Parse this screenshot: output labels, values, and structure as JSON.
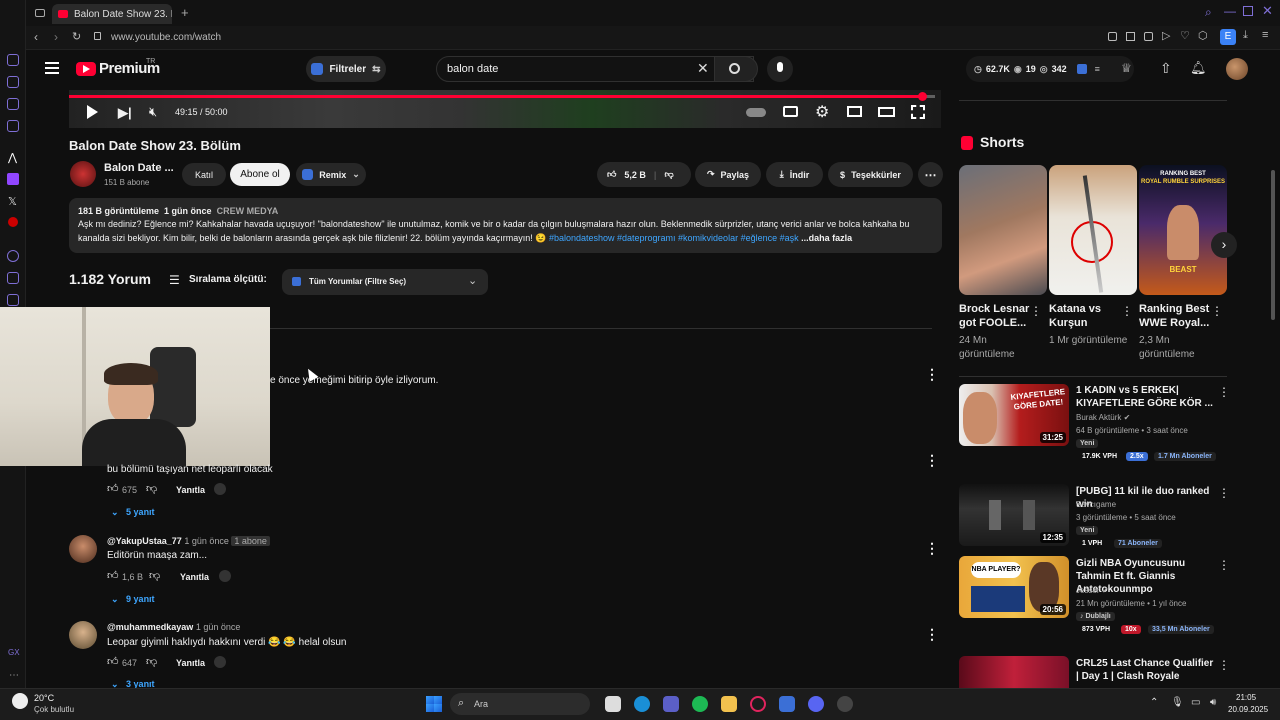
{
  "browser": {
    "tab_title": "Balon Date Show 23. Bölüm",
    "url": "www.youtube.com/watch"
  },
  "masthead": {
    "logo": "Premium",
    "logo_sup": "TR",
    "filter_label": "Filtreler",
    "search_value": "balon date",
    "stats": {
      "views": "62.7K",
      "watching": "19",
      "other": "342"
    },
    "colors": {
      "brand": "#ff0033",
      "accent": "#3ea6ff"
    }
  },
  "player": {
    "time": "49:15 / 50:00",
    "progress": 0.985
  },
  "video": {
    "title": "Balon Date Show 23. Bölüm",
    "channel": "Balon Date ...",
    "subscribers": "151 B abone",
    "join_label": "Katıl",
    "subscribe_label": "Abone ol",
    "remix_label": "Remix",
    "likes": "5,2 B",
    "share_label": "Paylaş",
    "download_label": "İndir",
    "thanks_label": "Teşekkürler"
  },
  "description": {
    "views": "181 B görüntüleme",
    "age": "1 gün önce",
    "channel_tag": "CREW MEDYA",
    "text_line1": "Aşk mı dediniz? Eğlence mi? Kahkahalar havada uçuşuyor! \"balondateshow\" ile unutulmaz, komik ve bir o kadar da çılgın buluşmalara hazır olun. Beklenmedik sürprizler, utanç verici anlar ve bolca kahkaha bu",
    "text_line2": "kanalda sizi bekliyor. Kim bilir, belki de balonların arasında gerçek aşk bile filizlenir! 22. bölüm yayında kaçırmayın! 😉",
    "hashtags": "#balondateshow #dateprogramı #komikvideolar #eğlence #aşk",
    "more": "...daha fazla"
  },
  "comments_header": {
    "count": "1.182 Yorum",
    "sort_label": "Sıralama ölçütü:",
    "filter_value": "Tüm Yorumlar (Filtre Seç)"
  },
  "comments": [
    {
      "text": "e önce yemeğimi bitirip öyle izliyorum."
    },
    {
      "text": "bu bölümü taşıyan net leoparlı olacak",
      "likes": "675",
      "reply": "Yanıtla",
      "replies": "5 yanıt"
    },
    {
      "user": "@YakupUstaa_77",
      "age": "1 gün önce",
      "badge": "1 abone",
      "text": "Editörün maaşa zam...",
      "likes": "1,6 B",
      "reply": "Yanıtla",
      "replies": "9 yanıt"
    },
    {
      "user": "@muhammedkayaw",
      "age": "1 gün önce",
      "text": "Leopar giyimli haklıydı hakkını verdi 😂 😂  helal olsun",
      "likes": "647",
      "reply": "Yanıtla",
      "replies": "3 yanıt"
    }
  ],
  "shorts": {
    "heading": "Shorts",
    "items": [
      {
        "title": "Brock Lesnar got FOOLE...",
        "views": "24 Mn görüntüleme"
      },
      {
        "title": "Katana vs Kurşun",
        "views": "1 Mr görüntüleme"
      },
      {
        "title": "Ranking Best WWE Royal...",
        "views": "2,3 Mn görüntüleme",
        "thumb_top": "RANKING BEST",
        "thumb_sub": "ROYAL RUMBLE SURPRISES",
        "thumb_label": "BEAST"
      }
    ]
  },
  "recommended": [
    {
      "title": "1 KADIN vs 5 ERKEK| KIYAFETLERE GÖRE KÖR ...",
      "channel": "Burak Aktürk",
      "meta": "64 B görüntüleme • 3 saat önce",
      "tag": "Yeni",
      "duration": "31:25",
      "thumb_text": "KIYAFETLERE GÖRE DATE!",
      "vph": "17.9K VPH",
      "mult": "2.5x",
      "subs": "1.7 Mn Aboneler"
    },
    {
      "title": "[PUBG] 11 kil ile duo ranked win",
      "channel": "Savcıgame",
      "meta": "3 görüntüleme • 5 saat önce",
      "tag": "Yeni",
      "duration": "12:35",
      "vph": "1 VPH",
      "subs": "71 Aboneler"
    },
    {
      "title": "Gizli NBA Oyuncusunu Tahmin Et ft. Giannis Antetokounmpo",
      "channel": "Jesser",
      "meta": "21 Mn görüntüleme • 1 yıl önce",
      "tag": "Dublajlı",
      "duration": "20:56",
      "thumb_text": "NBA PLAYER?",
      "vph": "873 VPH",
      "mult": "10x",
      "subs": "33,5 Mn Aboneler"
    },
    {
      "title": "CRL25 Last Chance Qualifier | Day 1 | Clash Royale"
    }
  ],
  "taskbar": {
    "weather_temp": "20°C",
    "weather_desc": "Çok bulutlu",
    "search_label": "Ara",
    "time": "21:05",
    "date": "20.09.2025"
  }
}
